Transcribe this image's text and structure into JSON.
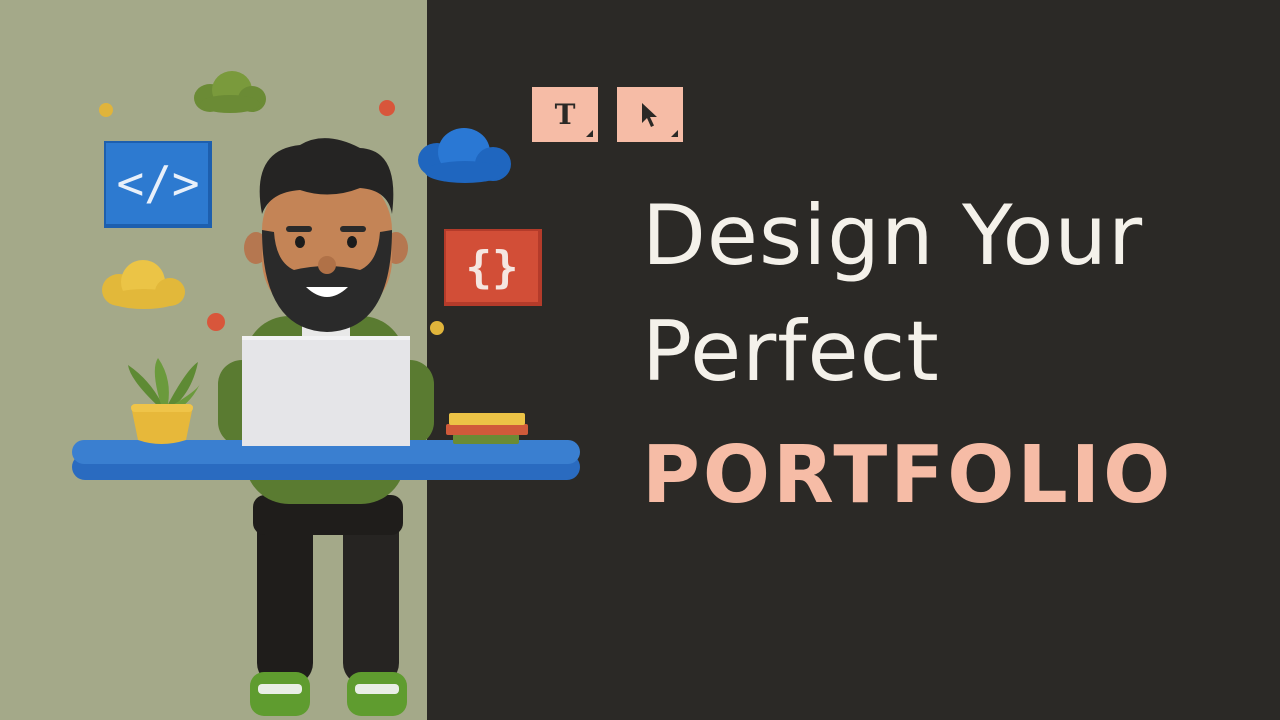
{
  "headline": {
    "line1": "Design Your",
    "line2": "Perfect",
    "line3": "PORTFOLIO"
  },
  "badges": {
    "code_tag": "</>",
    "braces": "{}"
  },
  "tools": {
    "text_tool_glyph": "T"
  },
  "colors": {
    "left_background": "#a4a989",
    "right_background": "#2b2926",
    "headline_text": "#f4f1ea",
    "accent": "#f6bca6",
    "desk_blue": "#3a7fd0"
  },
  "icons": [
    "code-tag-icon",
    "curly-braces-icon",
    "text-tool-icon",
    "cursor-tool-icon",
    "cloud-icon",
    "plant-icon",
    "laptop-icon",
    "books-icon"
  ]
}
